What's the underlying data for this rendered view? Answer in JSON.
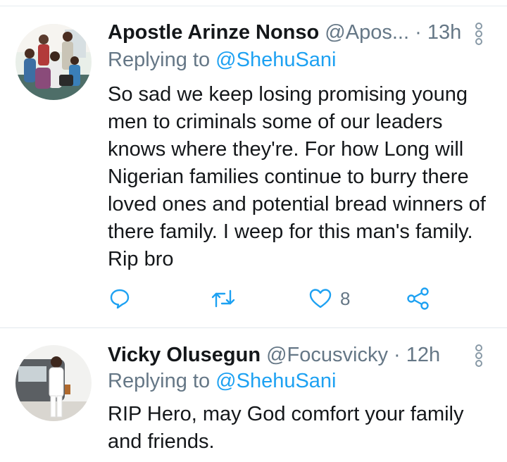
{
  "tweets": [
    {
      "name": "Apostle Arinze Nonso",
      "handle": "@Apos...",
      "separator": "·",
      "time": "13h",
      "replying_prefix": "Replying to",
      "replying_to": "@ShehuSani",
      "text": "So sad we keep losing promising young men to criminals some of our leaders knows where they're. For how Long will Nigerian families continue to burry there loved ones and potential bread winners of there family. I weep for this man's family. Rip bro",
      "actions": {
        "reply_icon": "speech-bubble-icon",
        "retweet_icon": "retweet-icon",
        "like_icon": "heart-icon",
        "like_count": "8",
        "share_icon": "share-icon"
      }
    },
    {
      "name": "Vicky Olusegun",
      "handle": "@Focusvicky",
      "separator": "·",
      "time": "12h",
      "replying_prefix": "Replying to",
      "replying_to": "@ShehuSani",
      "text": "RIP Hero, may God comfort your family and friends."
    }
  ],
  "colors": {
    "secondary_text": "#657786",
    "link": "#1da1f2",
    "divider": "#e1e8ed"
  }
}
